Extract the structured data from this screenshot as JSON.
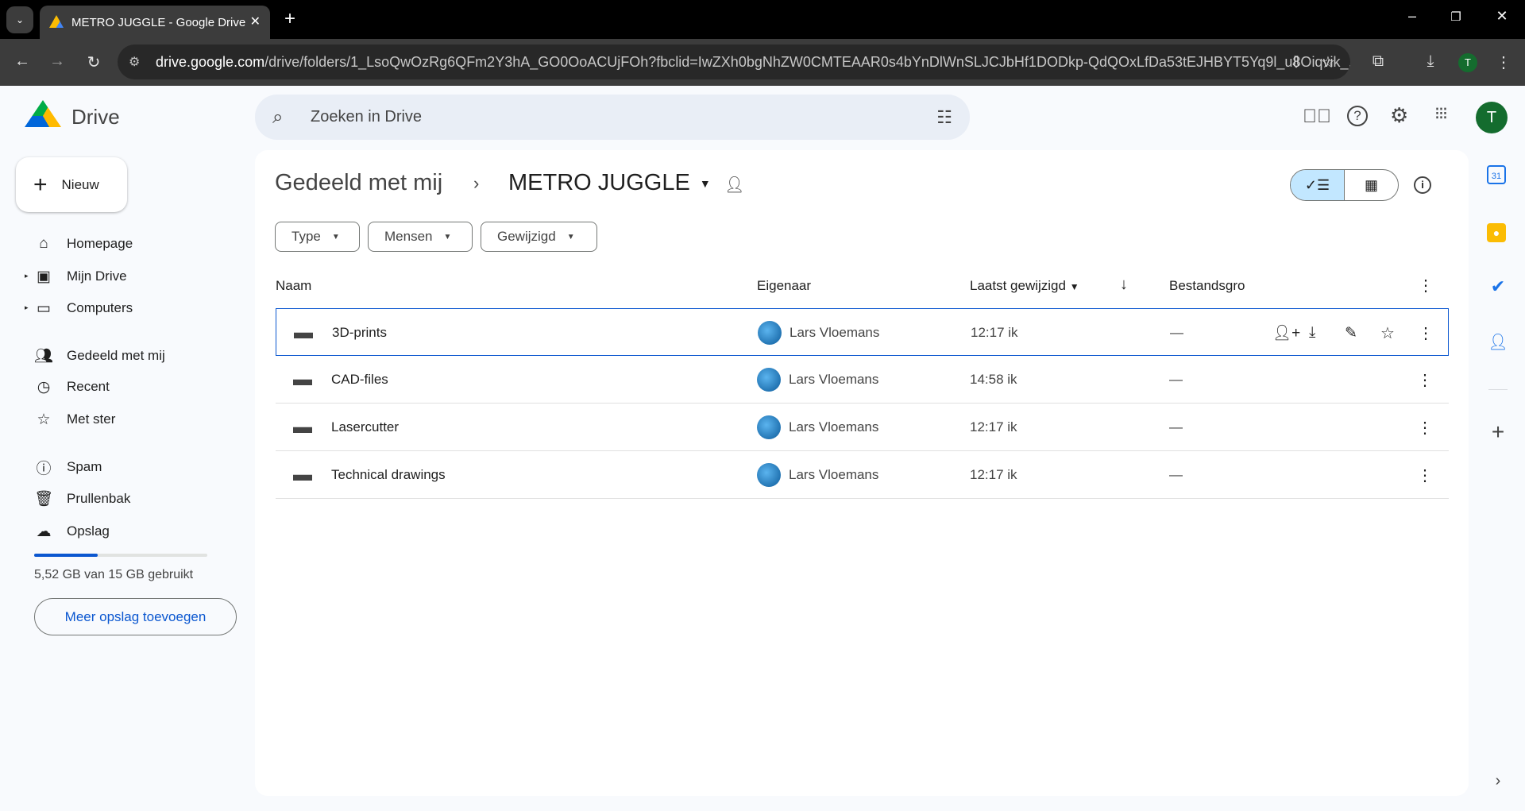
{
  "browser": {
    "tab_title": "METRO JUGGLE - Google Drive",
    "url_host": "drive.google.com",
    "url_path": "/drive/folders/1_LsoQwOzRg6QFm2Y3hA_GO0OoACUjFOh?fbclid=IwZXh0bgNhZW0CMTEAAR0s4bYnDlWnSLJCJbHf1DODkp-QdQOxLfDa53tEJHBYT5Yq9l_u8Oiqvik_...",
    "profile_initial": "T"
  },
  "app": {
    "name": "Drive",
    "search_placeholder": "Zoeken in Drive",
    "avatar_initial": "T"
  },
  "sidebar": {
    "new_label": "Nieuw",
    "items": [
      {
        "label": "Homepage",
        "icon": "home-icon"
      },
      {
        "label": "Mijn Drive",
        "icon": "my-drive-icon"
      },
      {
        "label": "Computers",
        "icon": "computers-icon"
      },
      {
        "label": "Gedeeld met mij",
        "icon": "shared-icon"
      },
      {
        "label": "Recent",
        "icon": "clock-icon"
      },
      {
        "label": "Met ster",
        "icon": "star-icon"
      },
      {
        "label": "Spam",
        "icon": "spam-icon"
      },
      {
        "label": "Prullenbak",
        "icon": "trash-icon"
      },
      {
        "label": "Opslag",
        "icon": "cloud-icon"
      }
    ],
    "storage_text": "5,52 GB van 15 GB gebruikt",
    "storage_used_fraction": 0.368,
    "storage_button": "Meer opslag toevoegen"
  },
  "breadcrumb": {
    "parent": "Gedeeld met mij",
    "current": "METRO JUGGLE"
  },
  "filters": [
    "Type",
    "Mensen",
    "Gewijzigd"
  ],
  "columns": {
    "name": "Naam",
    "owner": "Eigenaar",
    "modified": "Laatst gewijzigd",
    "size": "Bestandsgro"
  },
  "rows": [
    {
      "name": "3D-prints",
      "owner": "Lars Vloemans",
      "modified": "12:17 ik",
      "size": "—"
    },
    {
      "name": "CAD-files",
      "owner": "Lars Vloemans",
      "modified": "14:58 ik",
      "size": "—"
    },
    {
      "name": "Lasercutter",
      "owner": "Lars Vloemans",
      "modified": "12:17 ik",
      "size": "—"
    },
    {
      "name": "Technical drawings",
      "owner": "Lars Vloemans",
      "modified": "12:17 ik",
      "size": "—"
    }
  ],
  "colors": {
    "accent": "#0b57d0",
    "selected_view": "#c2e7ff",
    "avatar": "#146c2e"
  }
}
